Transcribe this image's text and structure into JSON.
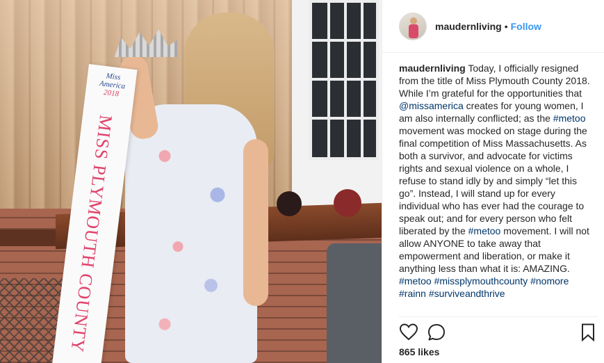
{
  "photo": {
    "sash_logo_line1": "Miss",
    "sash_logo_line2": "America",
    "sash_logo_year": "2018",
    "sash_text": "MISS PLYMOUTH COUNTY"
  },
  "header": {
    "username": "maudernliving",
    "separator": "•",
    "follow_label": "Follow"
  },
  "caption": {
    "username": "maudernliving",
    "segments": [
      {
        "type": "text",
        "value": " Today, I officially resigned from the title of Miss Plymouth County 2018. While I’m grateful for the opportunities that "
      },
      {
        "type": "tag",
        "value": "@missamerica"
      },
      {
        "type": "text",
        "value": " creates for young women, I am also internally conflicted; as the "
      },
      {
        "type": "tag",
        "value": "#metoo"
      },
      {
        "type": "text",
        "value": " movement was mocked on stage during the final competition of Miss Massachusetts. As both a survivor, and advocate for victims rights and sexual violence on a whole, I refuse to stand idly by and simply “let this go”. Instead, I will stand up for every individual who has ever had the courage to speak out; and for every person who felt liberated by the "
      },
      {
        "type": "tag",
        "value": "#metoo"
      },
      {
        "type": "text",
        "value": " movement. I will not allow ANYONE to take away that empowerment and liberation, or make it anything less than what it is: AMAZING. "
      },
      {
        "type": "tag",
        "value": "#metoo"
      },
      {
        "type": "text",
        "value": " "
      },
      {
        "type": "tag",
        "value": "#missplymouthcounty"
      },
      {
        "type": "text",
        "value": " "
      },
      {
        "type": "tag",
        "value": "#nomore"
      },
      {
        "type": "text",
        "value": " "
      },
      {
        "type": "tag",
        "value": "#rainn"
      },
      {
        "type": "text",
        "value": " "
      },
      {
        "type": "tag",
        "value": "#surviveandthrive"
      }
    ]
  },
  "actions": {
    "like_icon": "heart-icon",
    "comment_icon": "comment-bubble-icon",
    "save_icon": "bookmark-icon"
  },
  "likes": {
    "count": "865",
    "label": "likes"
  },
  "colors": {
    "follow": "#3897f0",
    "tag": "#003569",
    "text": "#262626",
    "divider": "#efefef"
  }
}
